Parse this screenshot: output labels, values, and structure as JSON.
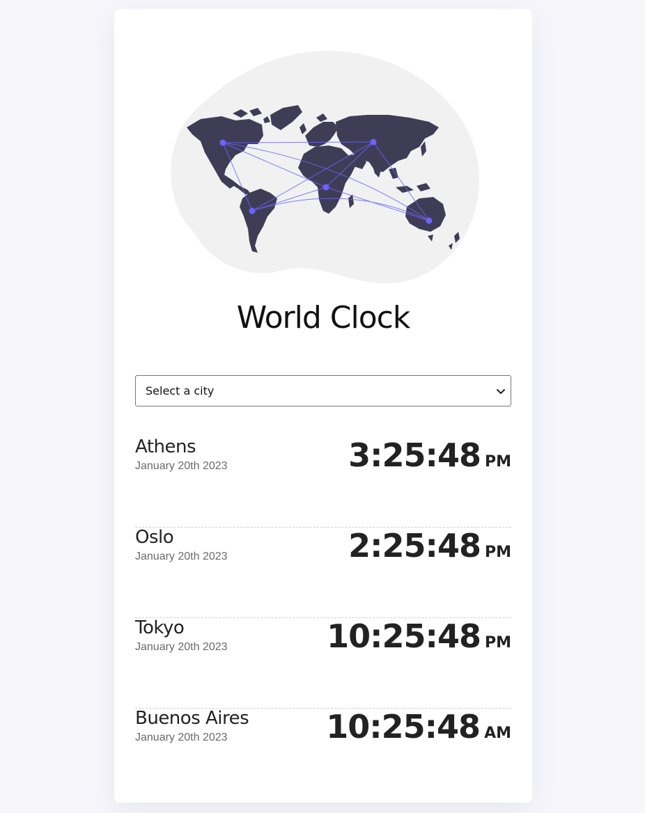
{
  "header": {
    "title": "World Clock"
  },
  "city_select": {
    "selected": "Select a city"
  },
  "colors": {
    "blob": "#f1f1f1",
    "continents": "#3f3d56",
    "accent": "#6c63ff"
  },
  "cities": [
    {
      "name": "Athens",
      "date": "January 20th 2023",
      "time": "3:25:48",
      "ampm": "PM"
    },
    {
      "name": "Oslo",
      "date": "January 20th 2023",
      "time": "2:25:48",
      "ampm": "PM"
    },
    {
      "name": "Tokyo",
      "date": "January 20th 2023",
      "time": "10:25:48",
      "ampm": "PM"
    },
    {
      "name": "Buenos Aires",
      "date": "January 20th 2023",
      "time": "10:25:48",
      "ampm": "AM"
    }
  ]
}
